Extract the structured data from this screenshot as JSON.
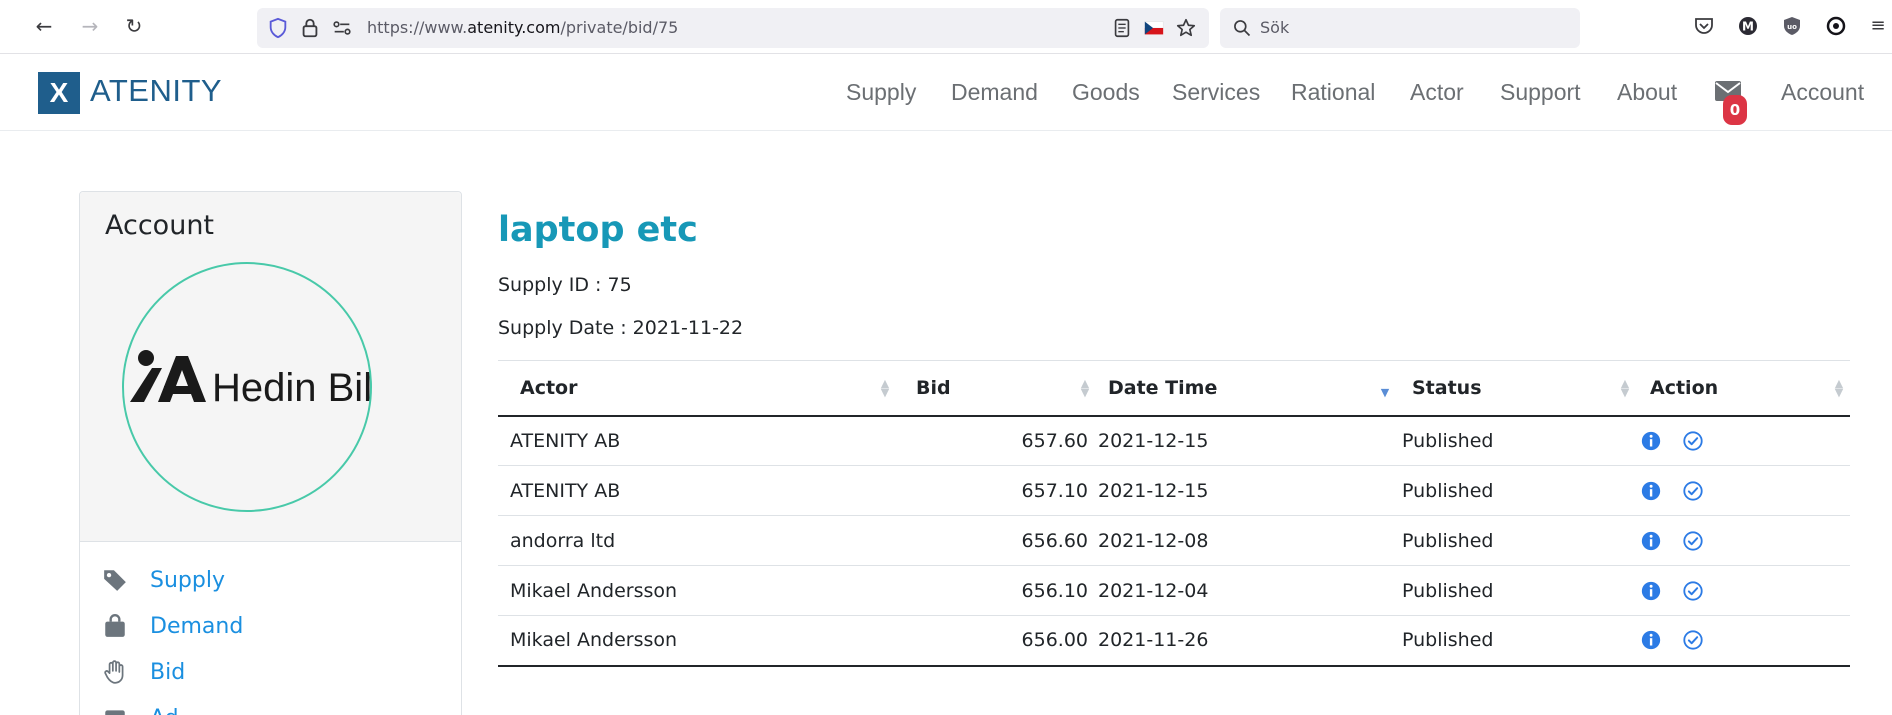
{
  "browser": {
    "url_prefix": "https://www.",
    "url_domain": "atenity.com",
    "url_path": "/private/bid/75",
    "search_placeholder": "Sök"
  },
  "header": {
    "logo_mark": "X",
    "logo_text": "ATENITY",
    "nav": [
      "Supply",
      "Demand",
      "Goods",
      "Services",
      "Rational",
      "Actor",
      "Support",
      "About"
    ],
    "message_count": "0",
    "account": "Account",
    "brand_color": "#1f5e8c"
  },
  "sidebar": {
    "title": "Account",
    "logo_text": "Hedin Bil",
    "items": [
      {
        "label": "Supply",
        "icon": "tag-icon"
      },
      {
        "label": "Demand",
        "icon": "shopping-bag-icon"
      },
      {
        "label": "Bid",
        "icon": "hand-icon"
      },
      {
        "label": "Ad",
        "icon": "ad-icon"
      }
    ]
  },
  "main": {
    "title": "laptop etc",
    "supply_id": "Supply ID : 75",
    "supply_date": "Supply Date : 2021-11-22",
    "columns": [
      "Actor",
      "Bid",
      "Date Time",
      "Status",
      "Action"
    ],
    "rows": [
      {
        "actor": "ATENITY AB",
        "bid": "657.60",
        "date": "2021-12-15",
        "status": "Published"
      },
      {
        "actor": "ATENITY AB",
        "bid": "657.10",
        "date": "2021-12-15",
        "status": "Published"
      },
      {
        "actor": "andorra ltd",
        "bid": "656.60",
        "date": "2021-12-08",
        "status": "Published"
      },
      {
        "actor": "Mikael Andersson",
        "bid": "656.10",
        "date": "2021-12-04",
        "status": "Published"
      },
      {
        "actor": "Mikael Andersson",
        "bid": "656.00",
        "date": "2021-11-26",
        "status": "Published"
      }
    ],
    "title_color": "#1798b7"
  }
}
